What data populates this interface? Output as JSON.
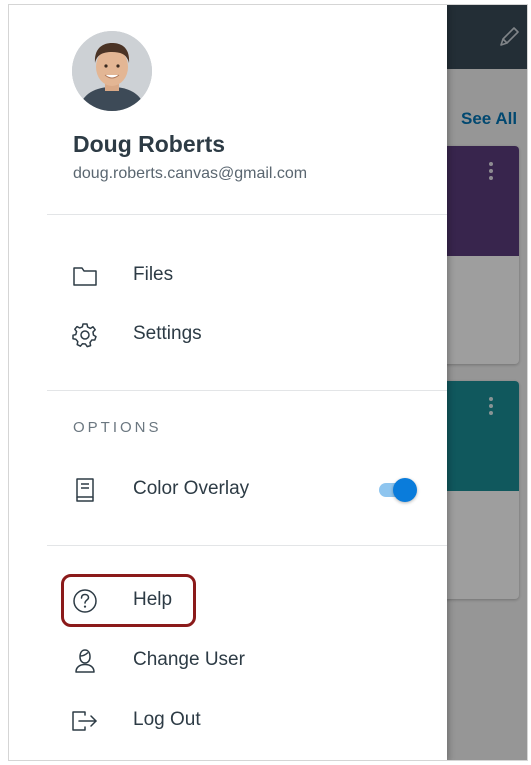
{
  "background": {
    "see_all": "See All"
  },
  "profile": {
    "name": "Doug Roberts",
    "email": "doug.roberts.canvas@gmail.com"
  },
  "menu": {
    "files": "Files",
    "settings": "Settings",
    "options_heading": "OPTIONS",
    "color_overlay": "Color Overlay",
    "color_overlay_enabled": true,
    "help": "Help",
    "change_user": "Change User",
    "log_out": "Log Out"
  },
  "colors": {
    "text_primary": "#2d3b45",
    "toggle_on": "#0a7cdb",
    "highlight_border": "#8b1a1a",
    "link": "#0374b5"
  }
}
